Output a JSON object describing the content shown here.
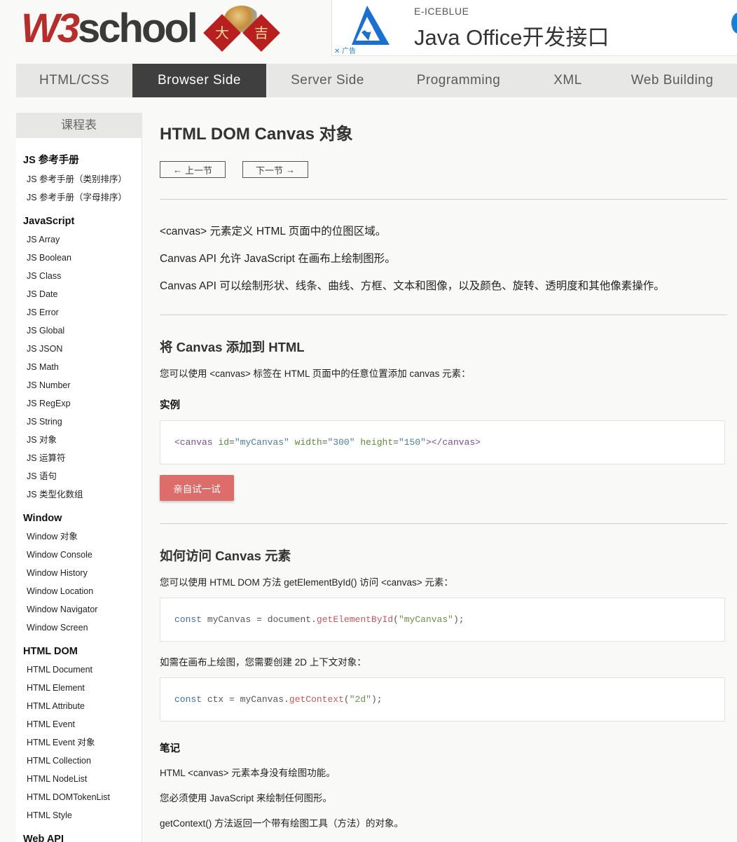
{
  "header": {
    "logo_w3": "W3",
    "logo_school": "school",
    "logo_badge_left": "大",
    "logo_badge_right": "吉",
    "ad": {
      "brand": "E-ICEBLUE",
      "title": "Java Office开发接口",
      "marker": "广告",
      "close_glyph": "✕"
    }
  },
  "nav": {
    "items": [
      {
        "label": "HTML/CSS",
        "active": false
      },
      {
        "label": "Browser Side",
        "active": true
      },
      {
        "label": "Server Side",
        "active": false
      },
      {
        "label": "Programming",
        "active": false
      },
      {
        "label": "XML",
        "active": false
      },
      {
        "label": "Web Building",
        "active": false
      }
    ]
  },
  "sidebar": {
    "title": "课程表",
    "groups": [
      {
        "label": "JS 参考手册",
        "items": [
          "JS 参考手册（类别排序）",
          "JS 参考手册（字母排序）"
        ]
      },
      {
        "label": "JavaScript",
        "items": [
          "JS Array",
          "JS Boolean",
          "JS Class",
          "JS Date",
          "JS Error",
          "JS Global",
          "JS JSON",
          "JS Math",
          "JS Number",
          "JS RegExp",
          "JS String",
          "JS 对象",
          "JS 运算符",
          "JS 语句",
          "JS 类型化数组"
        ]
      },
      {
        "label": "Window",
        "items": [
          "Window 对象",
          "Window Console",
          "Window History",
          "Window Location",
          "Window Navigator",
          "Window Screen"
        ]
      },
      {
        "label": "HTML DOM",
        "items": [
          "HTML Document",
          "HTML Element",
          "HTML Attribute",
          "HTML Event",
          "HTML Event 对象",
          "HTML Collection",
          "HTML NodeList",
          "HTML DOMTokenList",
          "HTML Style"
        ]
      },
      {
        "label": "Web API",
        "items": []
      }
    ]
  },
  "main": {
    "title": "HTML DOM Canvas 对象",
    "prev_label": "上一节",
    "next_label": "下一节",
    "intro": [
      "<canvas> 元素定义 HTML 页面中的位图区域。",
      "Canvas API 允许 JavaScript 在画布上绘制图形。",
      "Canvas API 可以绘制形状、线条、曲线、方框、文本和图像，以及颜色、旋转、透明度和其他像素操作。"
    ],
    "section1": {
      "heading": "将 Canvas 添加到 HTML",
      "text": "您可以使用 <canvas> 标签在 HTML 页面中的任意位置添加 canvas 元素：",
      "example_label": "实例",
      "code": {
        "open_tag": "<canvas",
        "id_attr": "id",
        "id_val": "\"myCanvas\"",
        "w_attr": "width",
        "w_val": "\"300\"",
        "h_attr": "height",
        "h_val": "\"150\"",
        "eq": "=",
        "close": "></canvas>"
      },
      "try_label": "亲自试一试"
    },
    "section2": {
      "heading": "如何访问 Canvas 元素",
      "text": "您可以使用 HTML DOM 方法 getElementById() 访问 <canvas> 元素：",
      "code1": {
        "kw": "const",
        "var": "myCanvas",
        "eq": "=",
        "obj": "document",
        "dot": ".",
        "fn": "getElementById",
        "open": "(",
        "arg": "\"myCanvas\"",
        "close": ");"
      },
      "text2": "如需在画布上绘图，您需要创建 2D 上下文对象：",
      "code2": {
        "kw": "const",
        "var": "ctx",
        "eq": "=",
        "obj": "myCanvas",
        "dot": ".",
        "fn": "getContext",
        "open": "(",
        "arg": "\"2d\"",
        "close": ");"
      },
      "notes_heading": "笔记",
      "notes": [
        "HTML <canvas> 元素本身没有绘图功能。",
        "您必须使用 JavaScript 来绘制任何图形。",
        "getContext() 方法返回一个带有绘图工具（方法）的对象。"
      ]
    }
  },
  "colors": {
    "brand_red": "#b72d2c",
    "nav_active": "#3f3f3f",
    "try_button": "#dc6d6b",
    "ad_blue": "#1a7fd4"
  }
}
